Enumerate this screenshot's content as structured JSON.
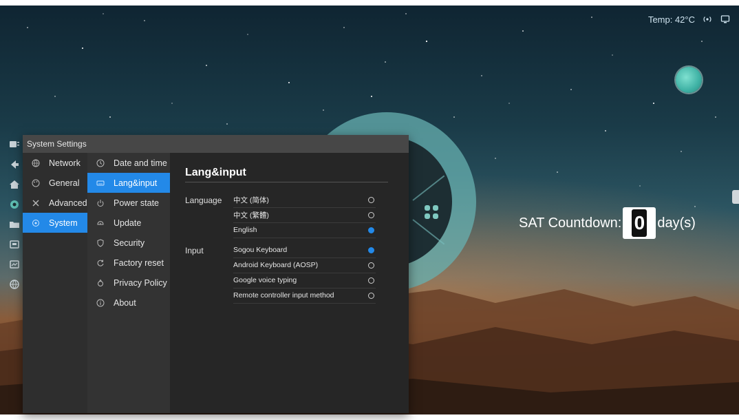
{
  "status": {
    "temperature": "Temp: 42°C"
  },
  "countdown": {
    "label": "SAT Countdown:",
    "digit": "0",
    "unit": "day(s)"
  },
  "settings": {
    "title": "System Settings",
    "categories": [
      {
        "label": "Network",
        "icon": "globe-icon",
        "active": false
      },
      {
        "label": "General",
        "icon": "palette-icon",
        "active": false
      },
      {
        "label": "Advanced",
        "icon": "tools-icon",
        "active": false
      },
      {
        "label": "System",
        "icon": "system-icon",
        "active": true
      }
    ],
    "subitems": [
      {
        "label": "Date and time",
        "icon": "clock-icon",
        "active": false
      },
      {
        "label": "Lang&input",
        "icon": "keyboard-icon",
        "active": true
      },
      {
        "label": "Power state",
        "icon": "power-icon",
        "active": false
      },
      {
        "label": "Update",
        "icon": "update-icon",
        "active": false
      },
      {
        "label": "Security",
        "icon": "shield-icon",
        "active": false
      },
      {
        "label": "Factory reset",
        "icon": "reset-icon",
        "active": false
      },
      {
        "label": "Privacy Policy",
        "icon": "privacy-icon",
        "active": false
      },
      {
        "label": "About",
        "icon": "info-icon",
        "active": false
      }
    ],
    "panel": {
      "title": "Lang&input",
      "language_label": "Language",
      "languages": [
        {
          "label": "中文 (简体)",
          "selected": false
        },
        {
          "label": "中文 (繁體)",
          "selected": false
        },
        {
          "label": "English",
          "selected": true
        }
      ],
      "input_label": "Input",
      "inputs": [
        {
          "label": "Sogou Keyboard",
          "selected": true
        },
        {
          "label": "Android Keyboard (AOSP)",
          "selected": false
        },
        {
          "label": "Google voice typing",
          "selected": false
        },
        {
          "label": "Remote controller input method",
          "selected": false
        }
      ]
    }
  },
  "colors": {
    "accent": "#2389e8",
    "ring": "#67b0b0",
    "window": "#262626"
  }
}
